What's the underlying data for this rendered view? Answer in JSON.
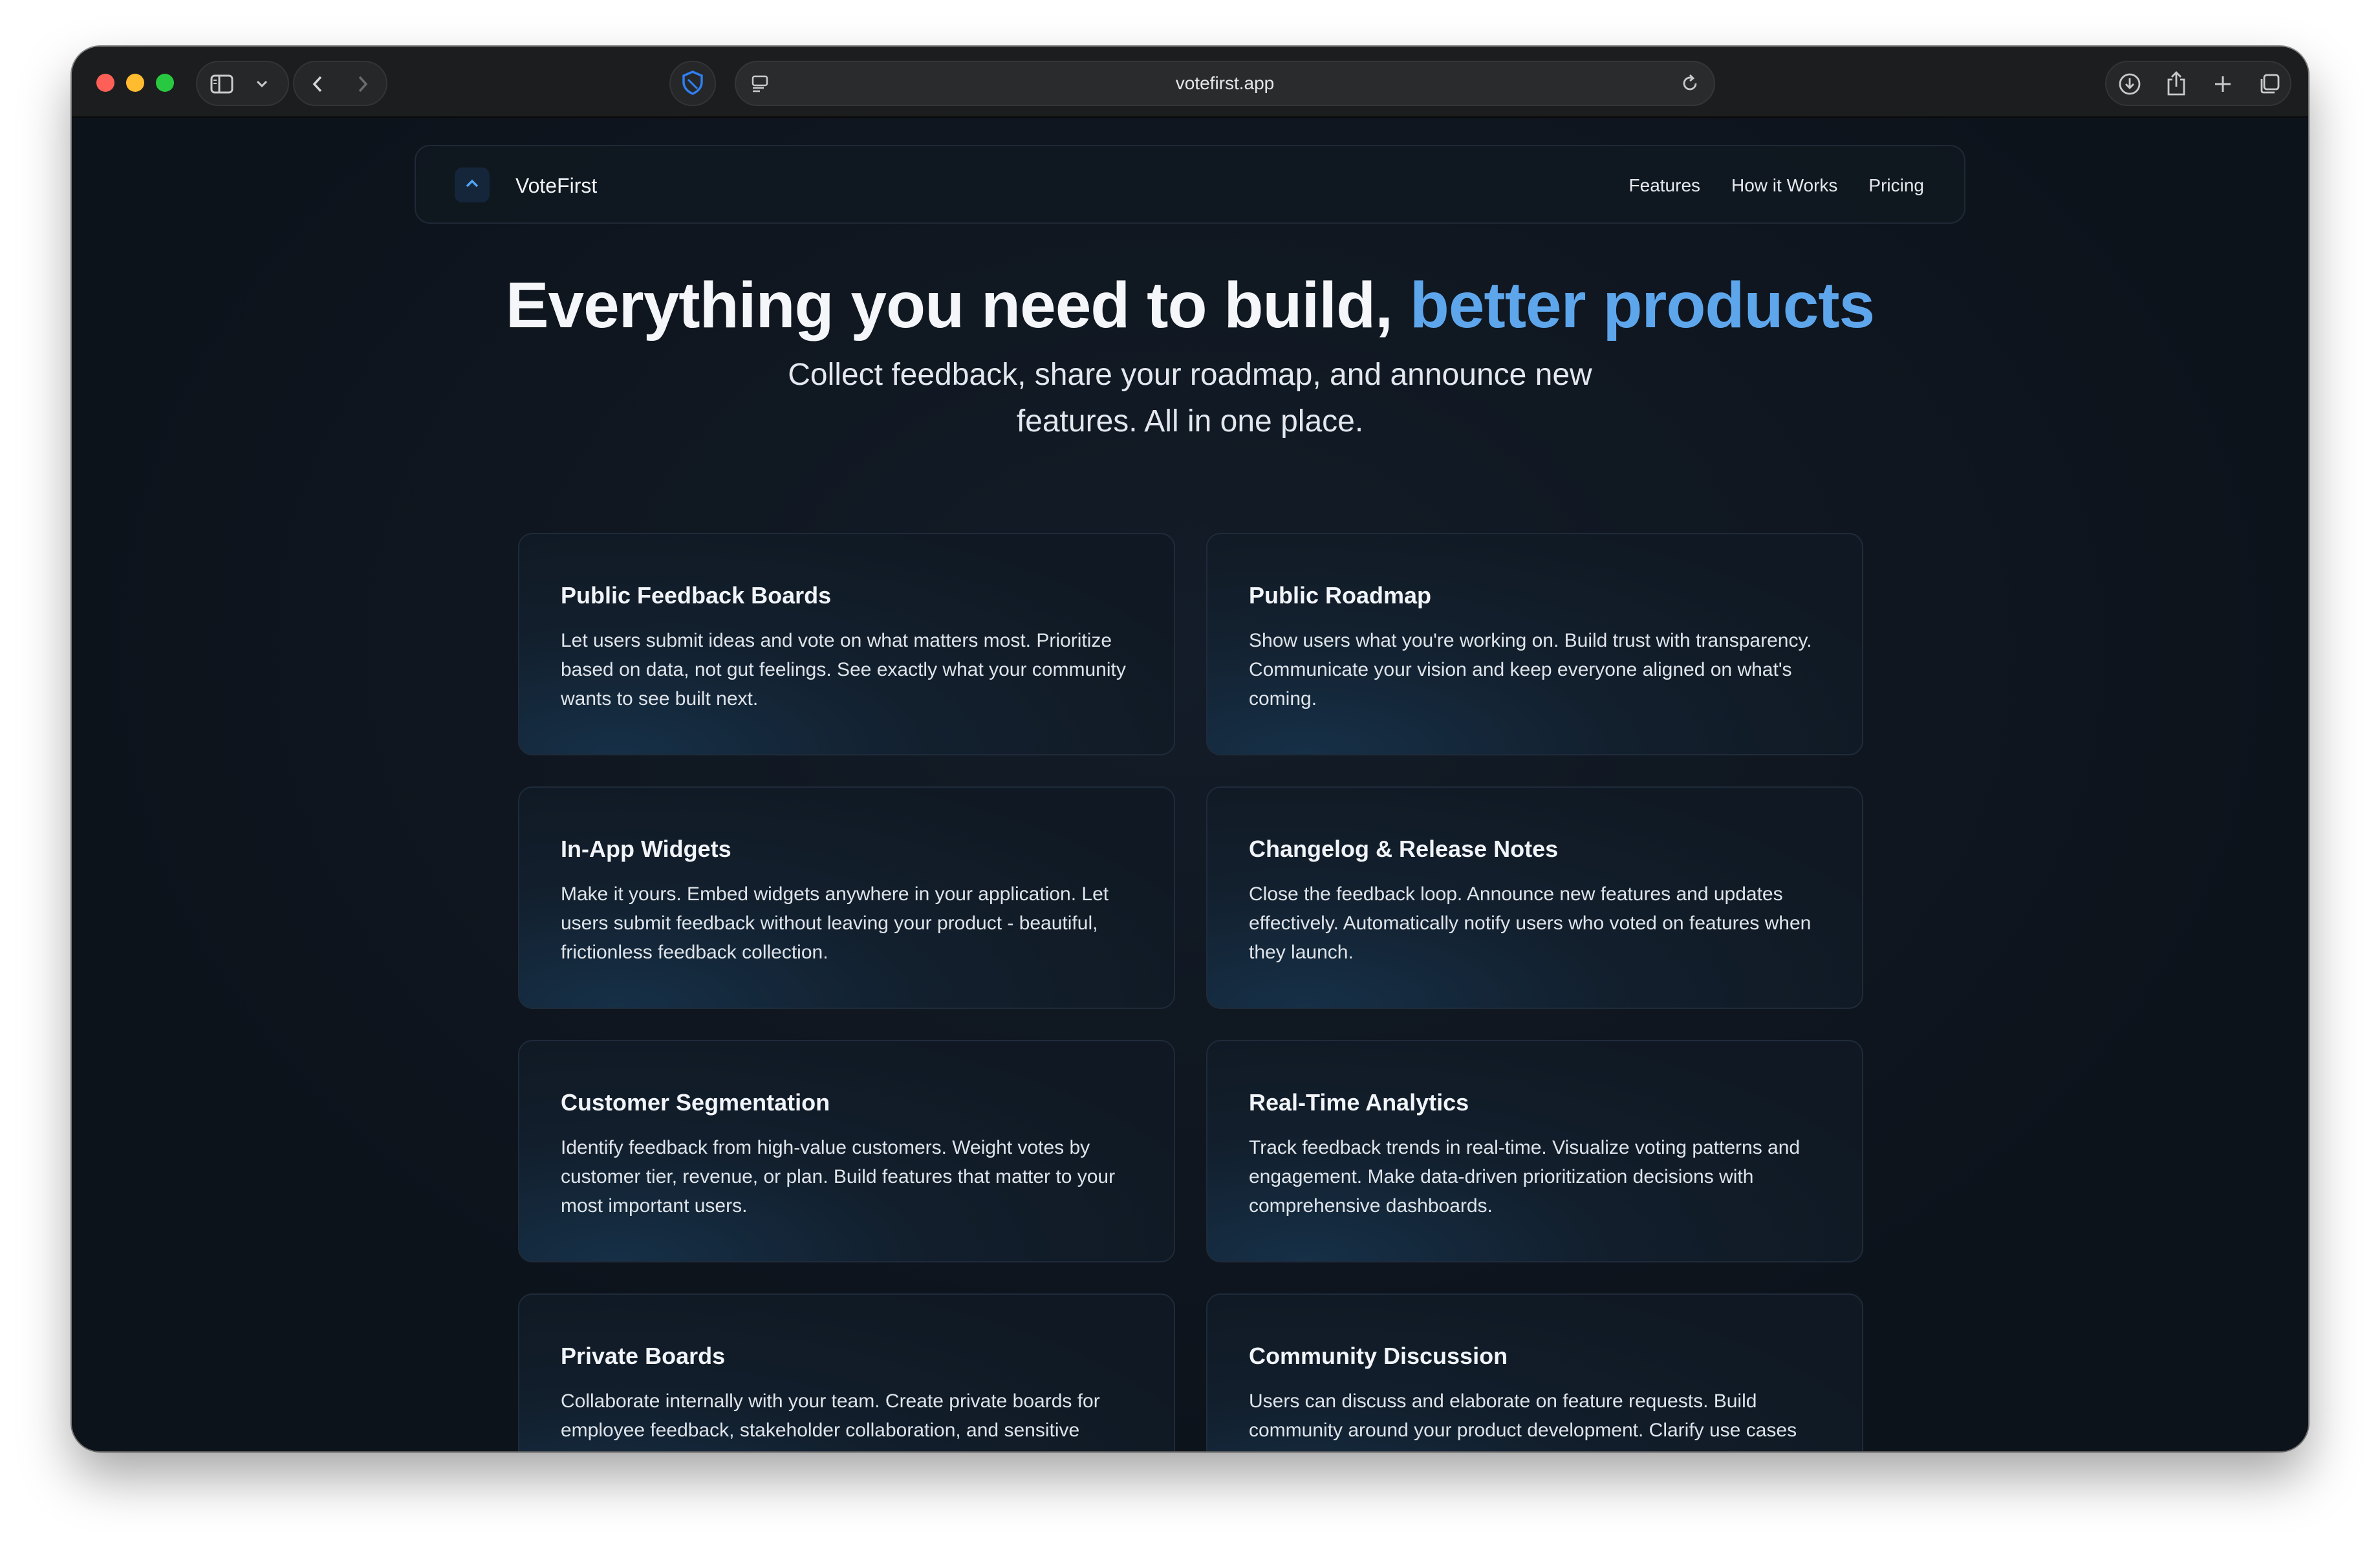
{
  "browser": {
    "url": "votefirst.app"
  },
  "nav": {
    "brand": "VoteFirst",
    "links": [
      "Features",
      "How it Works",
      "Pricing"
    ]
  },
  "hero": {
    "title_main": "Everything you need to build, ",
    "title_accent": "better products",
    "subtitle": "Collect feedback, share your roadmap, and announce new features. All in one place."
  },
  "features": [
    {
      "title": "Public Feedback Boards",
      "desc": "Let users submit ideas and vote on what matters most. Prioritize based on data, not gut feelings. See exactly what your community wants to see built next."
    },
    {
      "title": "Public Roadmap",
      "desc": "Show users what you're working on. Build trust with transparency. Communicate your vision and keep everyone aligned on what's coming."
    },
    {
      "title": "In-App Widgets",
      "desc": "Make it yours. Embed widgets anywhere in your application. Let users submit feedback without leaving your product - beautiful, frictionless feedback collection."
    },
    {
      "title": "Changelog & Release Notes",
      "desc": "Close the feedback loop. Announce new features and updates effectively. Automatically notify users who voted on features when they launch."
    },
    {
      "title": "Customer Segmentation",
      "desc": "Identify feedback from high-value customers. Weight votes by customer tier, revenue, or plan. Build features that matter to your most important users."
    },
    {
      "title": "Real-Time Analytics",
      "desc": "Track feedback trends in real-time. Visualize voting patterns and engagement. Make data-driven prioritization decisions with comprehensive dashboards."
    },
    {
      "title": "Private Boards",
      "desc": "Collaborate internally with your team. Create private boards for employee feedback, stakeholder collaboration, and sensitive discussions."
    },
    {
      "title": "Community Discussion",
      "desc": "Users can discuss and elaborate on feature requests. Build community around your product development. Clarify use cases and capture deeper insights."
    }
  ],
  "colors": {
    "accent": "#5ea6ec",
    "background": "#0e141d",
    "card_border": "#1f2b3a"
  }
}
